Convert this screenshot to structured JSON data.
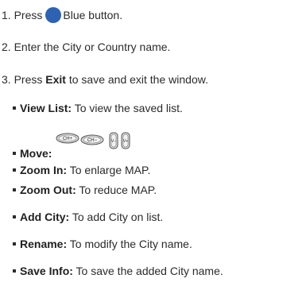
{
  "steps": [
    {
      "num": "1.",
      "pre": "Press",
      "post": "Blue button."
    },
    {
      "num": "2.",
      "text": "Enter the City or Country name."
    },
    {
      "num": "3.",
      "pre": "Press",
      "bold": "Exit",
      "post": "to save and exit the window."
    }
  ],
  "bullets": {
    "view_list": {
      "term": "View List:",
      "desc": "To view the saved list."
    },
    "move": {
      "term": "Move:"
    },
    "zoom_in": {
      "term": "Zoom In:",
      "desc": "To enlarge MAP."
    },
    "zoom_out": {
      "term": "Zoom Out:",
      "desc": "To reduce MAP."
    },
    "add_city": {
      "term": "Add City:",
      "desc": "To add City on list."
    },
    "rename": {
      "term": "Rename:",
      "desc": "To modify the City name."
    },
    "save_info": {
      "term": "Save Info:",
      "desc": "To save the added City name."
    }
  },
  "colors": {
    "blue_button": "#2e62b2",
    "text": "#2b2b2b"
  },
  "icons": [
    "blue-button-icon",
    "ch-plus-key-icon",
    "ch-minus-key-icon",
    "v-minus-key-icon",
    "v-plus-key-icon"
  ],
  "key_labels": [
    "CH+",
    "CH−",
    "V−",
    "V+"
  ]
}
